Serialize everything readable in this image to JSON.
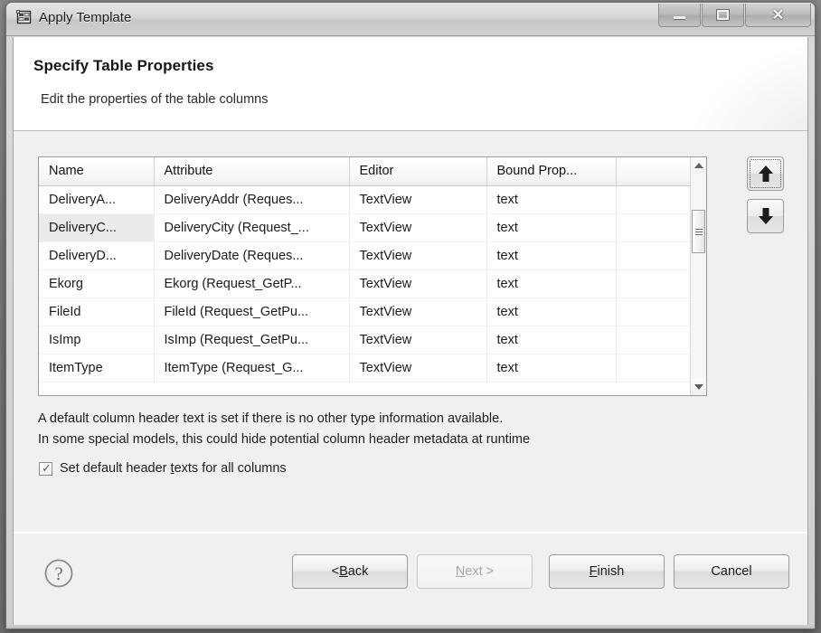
{
  "window": {
    "title": "Apply Template",
    "app_icon": "template-grid-icon",
    "controls": {
      "minimize": "minimize-icon",
      "maximize": "maximize-icon",
      "close": "close-icon"
    },
    "background_ghost_text": ""
  },
  "wizard": {
    "title": "Specify Table Properties",
    "subtitle": "Edit the properties of the table columns"
  },
  "table": {
    "columns": [
      {
        "key": "name",
        "label": "Name"
      },
      {
        "key": "attr",
        "label": "Attribute"
      },
      {
        "key": "editor",
        "label": "Editor"
      },
      {
        "key": "bound",
        "label": "Bound Prop..."
      },
      {
        "key": "extra",
        "label": ""
      }
    ],
    "rows": [
      {
        "name": "DeliveryA...",
        "attr": "DeliveryAddr (Reques...",
        "editor": "TextView",
        "bound": "text",
        "extra": "",
        "selected": false
      },
      {
        "name": "DeliveryC...",
        "attr": "DeliveryCity (Request_...",
        "editor": "TextView",
        "bound": "text",
        "extra": "",
        "selected": true
      },
      {
        "name": "DeliveryD...",
        "attr": "DeliveryDate (Reques...",
        "editor": "TextView",
        "bound": "text",
        "extra": "",
        "selected": false
      },
      {
        "name": "Ekorg",
        "attr": "Ekorg (Request_GetP...",
        "editor": "TextView",
        "bound": "text",
        "extra": "",
        "selected": false
      },
      {
        "name": "FileId",
        "attr": "FileId (Request_GetPu...",
        "editor": "TextView",
        "bound": "text",
        "extra": "",
        "selected": false
      },
      {
        "name": "IsImp",
        "attr": "IsImp (Request_GetPu...",
        "editor": "TextView",
        "bound": "text",
        "extra": "",
        "selected": false
      },
      {
        "name": "ItemType",
        "attr": "ItemType (Request_G...",
        "editor": "TextView",
        "bound": "text",
        "extra": "",
        "selected": false
      }
    ],
    "scrollbar": {
      "up_arrow": "scroll-up-icon",
      "down_arrow": "scroll-down-icon"
    }
  },
  "reorder": {
    "move_up": "arrow-up-icon",
    "move_down": "arrow-down-icon"
  },
  "description": {
    "line1": "A default column header text is set if there is no other type information available.",
    "line2": "In some special models, this could hide potential column header metadata at runtime"
  },
  "checkbox": {
    "checked": true,
    "check_glyph": "✓",
    "label_before": "Set default header ",
    "label_mnemonic": "t",
    "label_after": "exts for all columns"
  },
  "footer": {
    "help_icon": "help-question-icon",
    "buttons": [
      {
        "id": "back",
        "prefix": "< ",
        "mnemonic": "B",
        "suffix": "ack",
        "disabled": false
      },
      {
        "id": "next",
        "prefix": "",
        "mnemonic": "N",
        "suffix": "ext >",
        "disabled": true
      },
      {
        "id": "finish",
        "prefix": "",
        "mnemonic": "F",
        "suffix": "inish",
        "disabled": false
      },
      {
        "id": "cancel",
        "prefix": "",
        "mnemonic": "",
        "suffix": "Cancel",
        "disabled": false
      }
    ]
  },
  "colors": {
    "window_chrome": "#d5d5d5",
    "banner": "#ffffff",
    "body": "#f0f0f0",
    "selection": "#ebebeb",
    "border": "#9a9a9a"
  }
}
